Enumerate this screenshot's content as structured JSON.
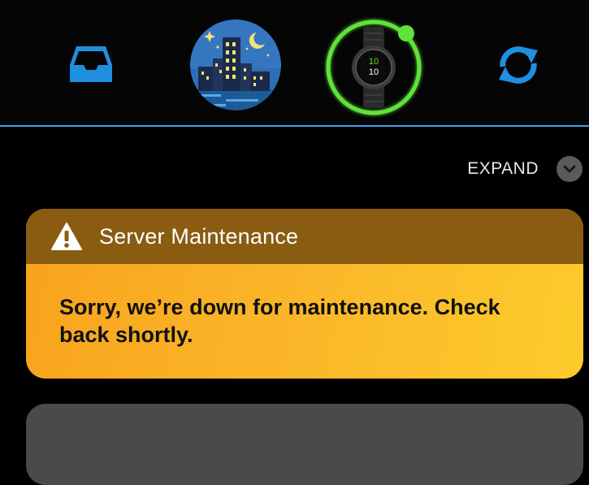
{
  "nav": {
    "inbox_icon": "inbox-tray-icon",
    "avatar_icon": "night-city-avatar",
    "device_icon": "smartwatch-icon",
    "device_face_hours": "10",
    "device_face_minutes": "10",
    "sync_icon": "sync-refresh-icon",
    "status_color": "#5fe33a",
    "accent_color": "#3aa0e6"
  },
  "expand": {
    "label": "EXPAND"
  },
  "notice": {
    "title": "Server Maintenance",
    "message": "Sorry, we’re down for maintenance. Check back shortly.",
    "icon": "warning-triangle-icon",
    "header_color": "#8a5c12",
    "body_color": "#fbb92a"
  }
}
